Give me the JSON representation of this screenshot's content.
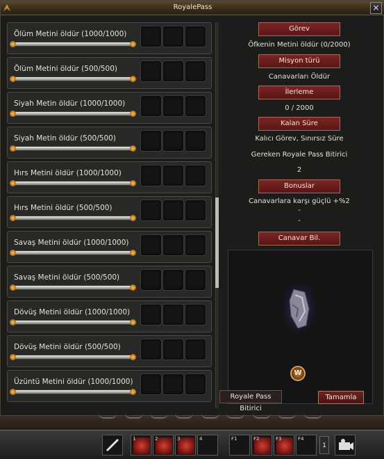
{
  "window": {
    "title": "RoyalePass",
    "close_label": "×"
  },
  "quests": [
    {
      "label": "Ölüm Metini öldür (1000/1000)",
      "progress": 1.0
    },
    {
      "label": "Ölüm Metini öldür (500/500)",
      "progress": 1.0
    },
    {
      "label": "Siyah Metin öldür (1000/1000)",
      "progress": 1.0
    },
    {
      "label": "Siyah Metin öldür (500/500)",
      "progress": 1.0
    },
    {
      "label": "Hırs Metini öldür (1000/1000)",
      "progress": 1.0
    },
    {
      "label": "Hırs Metini öldür (500/500)",
      "progress": 1.0
    },
    {
      "label": "Savaş Metini öldür (1000/1000)",
      "progress": 1.0
    },
    {
      "label": "Savaş Metini öldür (500/500)",
      "progress": 1.0
    },
    {
      "label": "Dövüş Metini öldür (1000/1000)",
      "progress": 1.0
    },
    {
      "label": "Dövüş Metini öldür (500/500)",
      "progress": 1.0
    },
    {
      "label": "Üzüntü Metini öldür (1000/1000)",
      "progress": 1.0
    }
  ],
  "details": {
    "gorev_header": "Görev",
    "gorev_value": "Öfkenin Metini öldür (0/2000)",
    "misyon_header": "Misyon türü",
    "misyon_value": "Canavarları Öldür",
    "ilerleme_header": "İlerleme",
    "ilerleme_value": "0 / 2000",
    "kalan_header": "Kalan Süre",
    "kalan_value": "Kalıcı Görev, Sınırsız Süre",
    "gereken_label": "Gereken Royale Pass Bitirici",
    "gereken_value": "2",
    "bonus_header": "Bonuslar",
    "bonus_1": "Canavarlara karşı güçlü +%2",
    "bonus_2": "-",
    "bonus_3": "-",
    "canavar_header": "Canavar Bil."
  },
  "buttons": {
    "royale_pass_bitirici": "Royale Pass Bitirici",
    "tamamla": "Tamamla",
    "w_icon": "W"
  },
  "taskbar": {
    "keys": [
      "1",
      "2",
      "3",
      "4",
      "F1",
      "F2",
      "F3",
      "F4"
    ],
    "page_number": "1"
  },
  "colors": {
    "header_red": "#6a1e1e",
    "gold": "#c89040"
  }
}
